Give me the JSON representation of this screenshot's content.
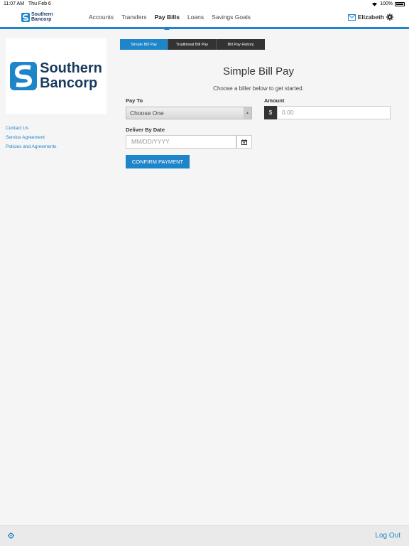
{
  "status_bar": {
    "time": "11:07 AM",
    "date": "Thu Feb 6",
    "battery": "100%"
  },
  "brand": {
    "line1": "Southern",
    "line2": "Bancorp"
  },
  "nav": {
    "items": [
      {
        "label": "Accounts"
      },
      {
        "label": "Transfers"
      },
      {
        "label": "Pay Bills",
        "active": true
      },
      {
        "label": "Loans"
      },
      {
        "label": "Savings Goals"
      }
    ],
    "user_name": "Elizabeth"
  },
  "logo": {
    "line1": "Southern",
    "line2": "Bancorp"
  },
  "links": [
    "Contact Us",
    "Service Agreement",
    "Policies and Agreements"
  ],
  "tabs": [
    {
      "label": "Simple Bill Pay",
      "active": true
    },
    {
      "label": "Traditional Bill Pay"
    },
    {
      "label": "Bill Pay History"
    }
  ],
  "page": {
    "title": "Simple Bill Pay",
    "subtitle": "Choose a biller below to get started."
  },
  "form": {
    "pay_to_label": "Pay To",
    "pay_to_value": "Choose One",
    "amount_label": "Amount",
    "currency_symbol": "$",
    "amount_placeholder": "0.00",
    "date_label": "Deliver By Date",
    "date_placeholder": "MM/DD/YYYY",
    "confirm_label": "CONFIRM PAYMENT"
  },
  "footer": {
    "logout_label": "Log Out"
  },
  "colors": {
    "accent": "#1e85c9",
    "brand_navy": "#1a3a5e",
    "dark_tab": "#333333"
  },
  "icons": [
    "wifi-icon",
    "battery-icon",
    "mail-icon",
    "gear-icon",
    "calendar-icon",
    "settings-icon"
  ]
}
